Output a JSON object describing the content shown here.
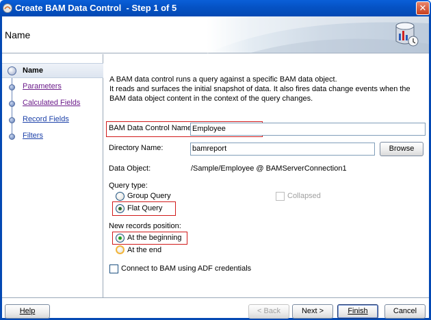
{
  "window": {
    "title": "Create BAM Data Control  - Step 1 of 5",
    "close_glyph": "✕"
  },
  "header": {
    "heading": "Name",
    "icon": "database-chart-icon"
  },
  "nav": {
    "items": [
      {
        "label": "Name",
        "state": "active"
      },
      {
        "label": "Parameters",
        "state": "visited"
      },
      {
        "label": "Calculated Fields",
        "state": "visited"
      },
      {
        "label": "Record Fields",
        "state": "link"
      },
      {
        "label": "Filters",
        "state": "link"
      }
    ]
  },
  "content": {
    "description_line1": "A BAM data control runs a query against a specific BAM data object.",
    "description_line2": "It reads and surfaces the initial snapshot of data. It also fires data change events when the",
    "description_line3": "BAM data object content in the context of the query changes.",
    "control_name_label": "BAM Data Control Name:",
    "control_name_value": "Employee",
    "directory_label": "Directory Name:",
    "directory_value": "bamreport",
    "browse_label": "Browse",
    "data_object_label": "Data Object:",
    "data_object_value": "/Sample/Employee @ BAMServerConnection1",
    "query_type_label": "Query type:",
    "group_query_label": "Group Query",
    "flat_query_label": "Flat Query",
    "collapsed_label": "Collapsed",
    "new_records_label": "New records position:",
    "at_beginning_label": "At the beginning",
    "at_end_label": "At the end",
    "adf_credentials_label": "Connect to BAM using ADF credentials"
  },
  "footer": {
    "help_label": "Help",
    "back_label": "< Back",
    "next_label": "Next >",
    "finish_label": "Finish",
    "cancel_label": "Cancel"
  },
  "colors": {
    "titlebar": "#0552c4",
    "highlight_red": "#d01818",
    "accent_blue": "#0449b3"
  }
}
